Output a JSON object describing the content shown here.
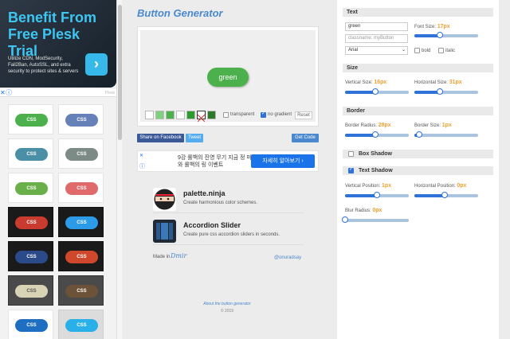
{
  "ad": {
    "title": "Benefit From Free Plesk Trial",
    "description": "Utilize CDN, ModSecurity, Fail2Ban, AutoSSL, and extra security to protect sites & servers",
    "arrow": "›",
    "close": "✕",
    "info": "ⓘ",
    "fine": "Plesk"
  },
  "tiles": [
    {
      "label": "CSS",
      "color": "#4cb14c"
    },
    {
      "label": "CSS",
      "color": "#6680b8"
    },
    {
      "label": "CSS",
      "color": "#4a8fa6"
    },
    {
      "label": "CSS",
      "color": "#7c8b86"
    },
    {
      "label": "CSS",
      "color": "#6ab04a"
    },
    {
      "label": "CSS",
      "color": "#e06a6a"
    },
    {
      "label": "CSS",
      "color": "#c93b2e"
    },
    {
      "label": "CSS",
      "color": "#2b9be8"
    },
    {
      "label": "CSS",
      "color": "#2a4a8a"
    },
    {
      "label": "CSS",
      "color": "#d0482c"
    },
    {
      "label": "CSS",
      "color": "#d9d3b5"
    },
    {
      "label": "CSS",
      "color": "#6b5238"
    },
    {
      "label": "CSS",
      "color": "#1e6fc2"
    },
    {
      "label": "CSS",
      "color": "#2ab0e8"
    }
  ],
  "generator": {
    "title": "Button Generator",
    "preview_label": "green",
    "swatches": [
      "#ffffff",
      "#7ed07e",
      "#4cb14c",
      "#ffffff",
      "#2c9a2c",
      "none",
      "#2a7a2a"
    ],
    "transparent_label": "transparent",
    "no_gradient_label": "no gradient",
    "reset_label": "Reset"
  },
  "share": {
    "facebook": "Share on Facebook",
    "tweet": "Tweet",
    "get_code": "Get Code"
  },
  "ad2": {
    "text": "9강 롤백의 진영 무기 지금 정 마기와 롤백의 링 이벤트",
    "button": "자세히 알아보기 ›",
    "close": "✕",
    "info": "ⓘ"
  },
  "promo": {
    "items": [
      {
        "title": "palette.ninja",
        "desc": "Create harmonious color schemes."
      },
      {
        "title": "Accordion Slider",
        "desc": "Create pure css accordion sliders in seconds."
      }
    ],
    "made_in": "Made in",
    "made_in_logo": "Dmir",
    "credit": "@onuradsay"
  },
  "footer": {
    "about": "About the button generator",
    "copyright": "© 2019"
  },
  "panel": {
    "text": {
      "header": "Text",
      "text_value": "green",
      "classname_placeholder": "classname: myButton",
      "font_value": "Arial",
      "font_size_label": "Font Size:",
      "font_size_value": "17px",
      "font_size_level": 0.4,
      "bold_label": "bold",
      "italic_label": "italic"
    },
    "size": {
      "header": "Size",
      "vertical_label": "Vertical Size:",
      "vertical_value": "16px",
      "vertical_level": 0.48,
      "horizontal_label": "Horizontal Size:",
      "horizontal_value": "31px",
      "horizontal_level": 0.4
    },
    "border": {
      "header": "Border",
      "radius_label": "Border Radius:",
      "radius_value": "28px",
      "radius_level": 0.48,
      "size_label": "Border Size:",
      "size_value": "1px",
      "size_level": 0.07
    },
    "box_shadow": {
      "label": "Box Shadow",
      "checked": false
    },
    "text_shadow": {
      "label": "Text Shadow",
      "checked": true,
      "vpos_label": "Vertical Position:",
      "vpos_value": "1px",
      "vpos_level": 0.5,
      "hpos_label": "Horizontal Position:",
      "hpos_value": "0px",
      "hpos_level": 0.48,
      "blur_label": "Blur Radius:",
      "blur_value": "0px",
      "blur_level": 0.0
    }
  }
}
